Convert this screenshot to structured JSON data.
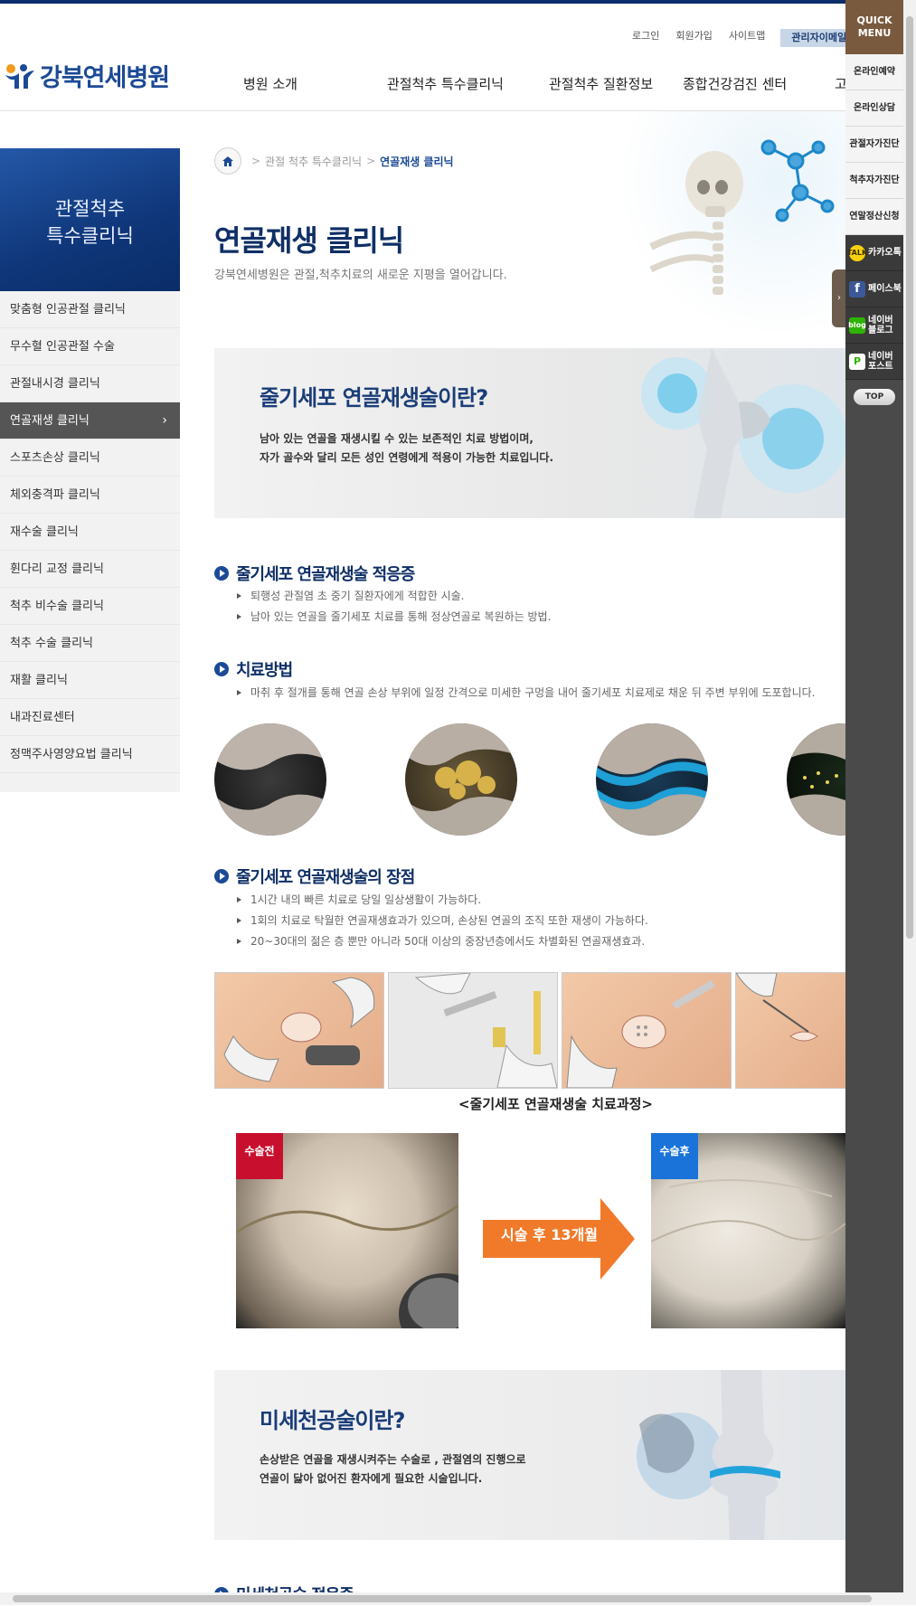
{
  "util_links": [
    "로그인",
    "회원가입",
    "사이트맵"
  ],
  "admin_label": "관리자이메일",
  "logo_text": "강북연세병원",
  "gnb": [
    "병원 소개",
    "관절척추 특수클리닉",
    "관절척추 질환정보",
    "종합건강검진 센터",
    "고"
  ],
  "snb_title": [
    "관절척추",
    "특수클리닉"
  ],
  "snb_items": [
    "맞춤형 인공관절 클리닉",
    "무수혈 인공관절 수술",
    "관절내시경 클리닉",
    "연골재생 클리닉",
    "스포츠손상 클리닉",
    "체외충격파 클리닉",
    "재수술 클리닉",
    "휜다리 교정 클리닉",
    "척추 비수술 클리닉",
    "척추 수술 클리닉",
    "재활 클리닉",
    "내과진료센터",
    "정맥주사영양요법 클리닉"
  ],
  "breadcrumb": {
    "parent": "관절 척추 특수클리닉",
    "current": "연골재생 클리닉"
  },
  "page_title": "연골재생 클리닉",
  "page_subtitle": "강북연세병원은 관절,척추치료의 새로운 지평을 열어갑니다.",
  "banner1": {
    "title": "줄기세포 연골재생술이란?",
    "line1": "남아 있는 연골을 재생시킬 수 있는 보존적인 치료 방법이며,",
    "line2": "자가 골수와 달리 모든 성인 연령에게 적용이 가능한 치료입니다."
  },
  "sec1": {
    "title": "줄기세포 연골재생술 적응증",
    "items": [
      "퇴행성 관절염 초 중기 질환자에게 적합한 시술.",
      "남아 있는 연골을 줄기세포 치료를 통해 정상연골로 복원하는 방법."
    ]
  },
  "sec2": {
    "title": "치료방법",
    "items": [
      "마취 후 절개를 통해 연골 손상 부위에 일정 간격으로 미세한 구멍을 내어 줄기세포 치료제로 채운 뒤 주변 부위에 도포합니다."
    ]
  },
  "sec3": {
    "title": "줄기세포 연골재생술의 장점",
    "items": [
      "1시간 내의 빠른 치료로 당일 일상생활이 가능하다.",
      "1회의 치료로 탁월한 연골재생효과가 있으며, 손상된 연골의 조직 또한 재생이 가능하다.",
      "20~30대의 젊은 층 뿐만 아니라 50대 이상의 중장년층에서도 차별화된 연골재생효과."
    ]
  },
  "process_caption": "<줄기세포 연골재생술 치료과정>",
  "before_tag": "수술전",
  "after_tag": "수술후",
  "arrow_text": "시술 후 13개월",
  "banner2": {
    "title": "미세천공술이란?",
    "line1": "손상받은 연골을 재생시켜주는 수술로 , 관절염의 진행으로",
    "line2": "연골이 닳아 없어진 환자에게 필요한 시술입니다."
  },
  "sec4_partial": "미세천공술 적응증",
  "quick": {
    "head1": "QUICK",
    "head2": "MENU",
    "items": [
      "온라인예약",
      "온라인상담",
      "관절자가진단",
      "척추자가진단",
      "연말정산신청"
    ],
    "kakao": "카카오톡",
    "facebook": "페이스북",
    "blog1": "네이버",
    "blog2": "블로그",
    "post1": "네이버",
    "post2": "포스트",
    "top": "TOP"
  },
  "colors": {
    "navy": "#0f2f66",
    "brand": "#1c4a95",
    "quick_bg": "#4a4a4a",
    "quick_head": "#7a5a3e",
    "arrow_orange": "#f07a2a"
  }
}
